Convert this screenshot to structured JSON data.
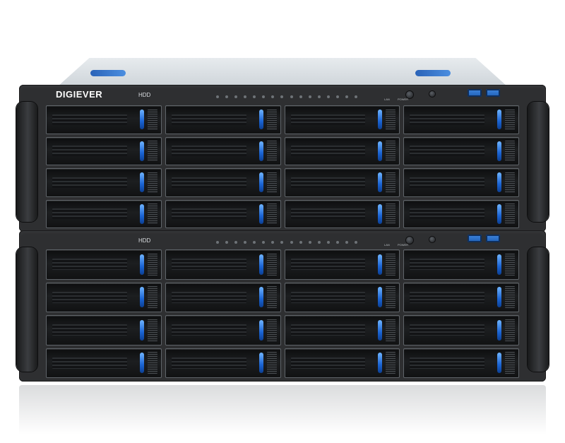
{
  "product": {
    "brand": "DIGIEVER",
    "top_unit": {
      "hdd_label": "HDD",
      "lan_label": "LAN",
      "power_label": "POWER",
      "bay_rows": 4,
      "bay_cols": 4
    },
    "bottom_unit": {
      "hdd_label": "HDD",
      "lan_label": "LAN",
      "power_label": "POWER",
      "bay_rows": 4,
      "bay_cols": 4
    },
    "accent_color": "#1a63d3",
    "chassis_color": "#2e2f31"
  }
}
